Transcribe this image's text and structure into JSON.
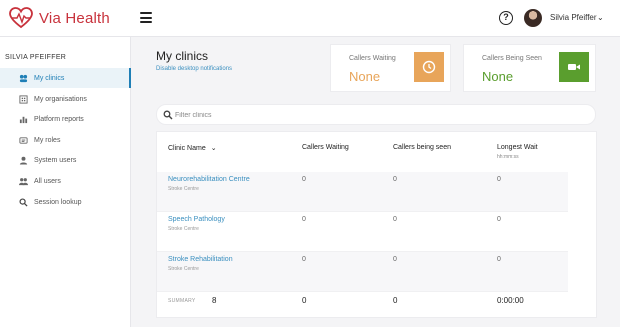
{
  "app": {
    "name": "Via Health"
  },
  "header": {
    "username": "Silvia Pfeiffer"
  },
  "sidebar": {
    "heading": "SILVIA PFEIFFER",
    "items": [
      {
        "label": "My clinics",
        "icon": "clinics-icon"
      },
      {
        "label": "My organisations",
        "icon": "organisations-icon"
      },
      {
        "label": "Platform reports",
        "icon": "reports-icon"
      },
      {
        "label": "My roles",
        "icon": "roles-icon"
      },
      {
        "label": "System users",
        "icon": "system-users-icon"
      },
      {
        "label": "All users",
        "icon": "all-users-icon"
      },
      {
        "label": "Session lookup",
        "icon": "search-icon"
      }
    ]
  },
  "main": {
    "title": "My clinics",
    "disable_link": "Disable desktop notifications"
  },
  "stats": {
    "waiting": {
      "label": "Callers Waiting",
      "value": "None",
      "color": "#e8a55a"
    },
    "seen": {
      "label": "Callers Being Seen",
      "value": "None",
      "color": "#5a9e2e"
    }
  },
  "search": {
    "placeholder": "Filter clinics"
  },
  "table": {
    "headers": {
      "clinic": "Clinic Name",
      "waiting": "Callers Waiting",
      "seen": "Callers being seen",
      "longest": "Longest Wait",
      "longest_sub": "hh:mm:ss"
    },
    "rows": [
      {
        "name": "Neurorehabilitation Centre",
        "sub": "Stroke Centre",
        "waiting": "0",
        "seen": "0",
        "longest": "0"
      },
      {
        "name": "Speech Pathology",
        "sub": "Stroke Centre",
        "waiting": "0",
        "seen": "0",
        "longest": "0"
      },
      {
        "name": "Stroke Rehabilitation",
        "sub": "Stroke Centre",
        "waiting": "0",
        "seen": "0",
        "longest": "0"
      }
    ],
    "summary": {
      "label": "SUMMARY",
      "count": "8",
      "waiting": "0",
      "seen": "0",
      "longest": "0:00:00"
    }
  }
}
